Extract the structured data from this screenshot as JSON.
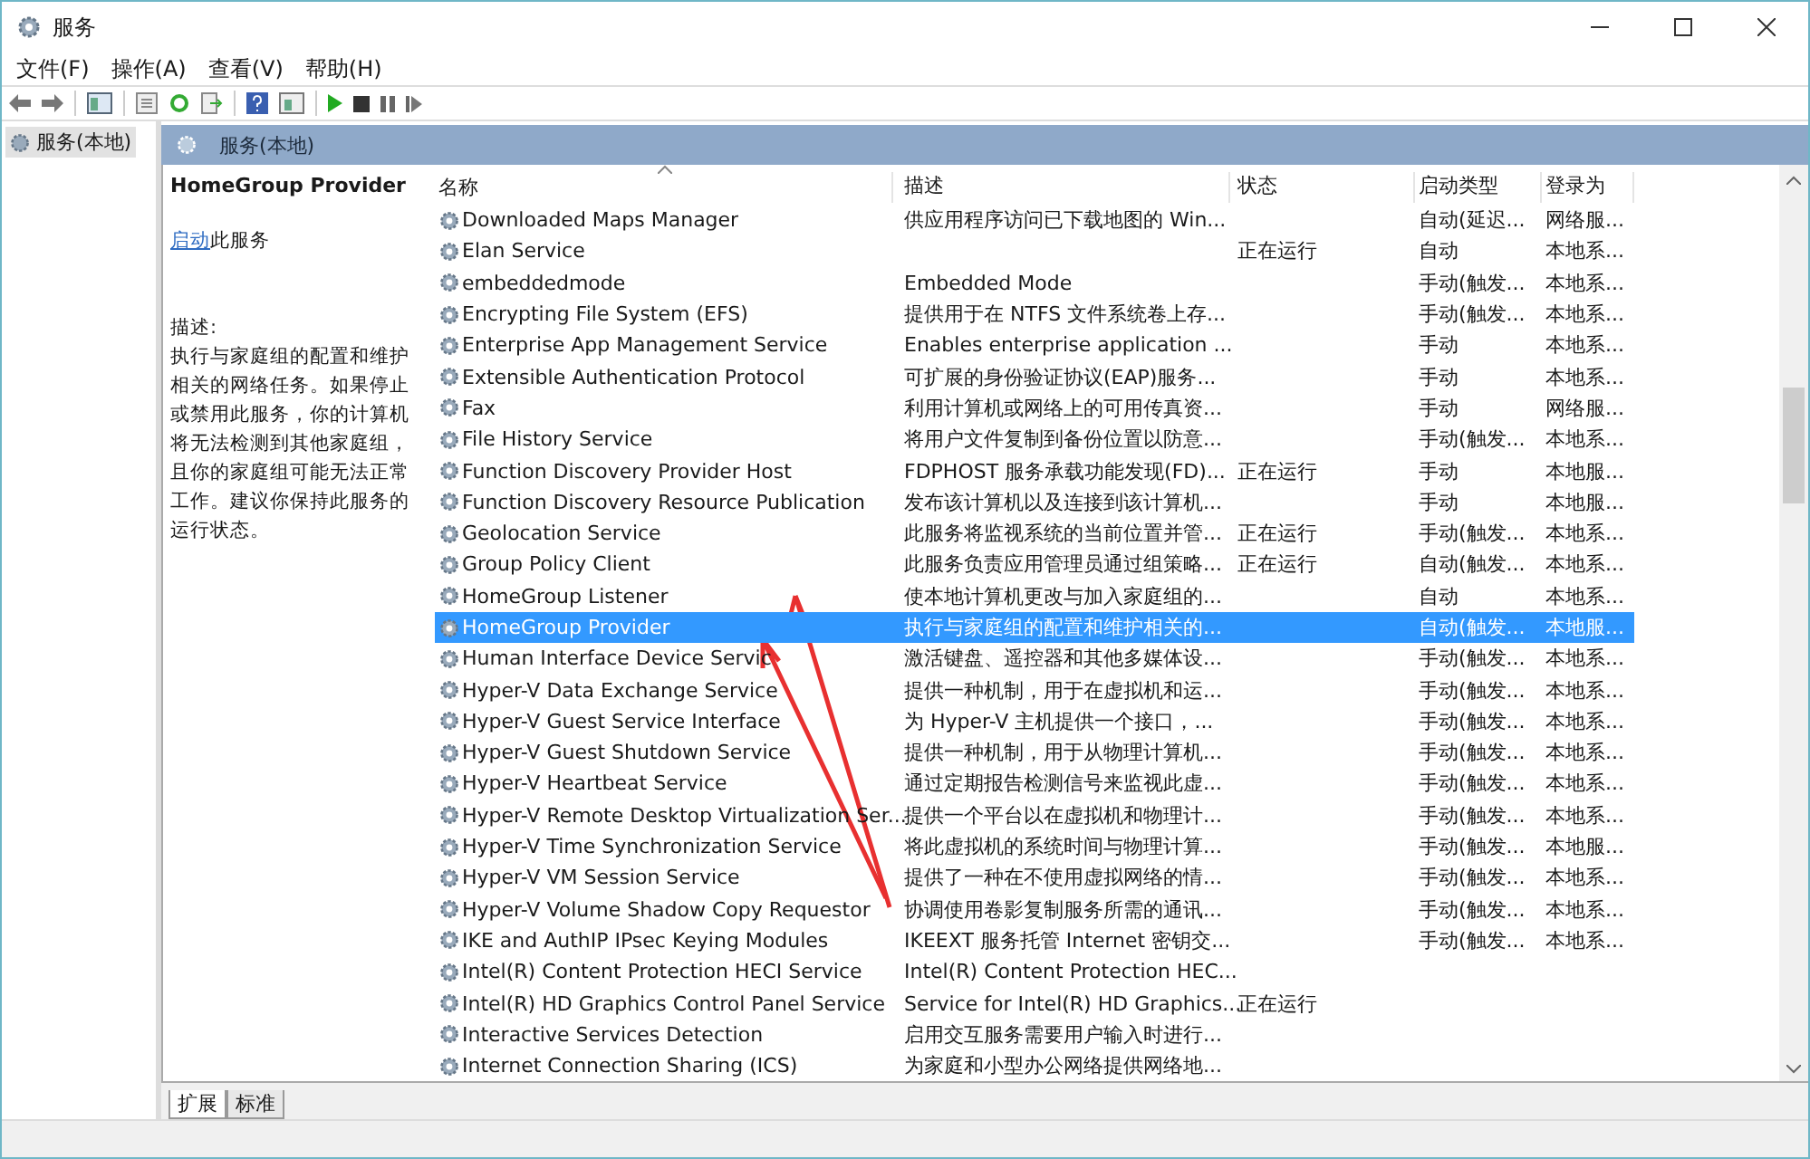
{
  "window": {
    "title": "服务"
  },
  "menu": [
    "文件(F)",
    "操作(A)",
    "查看(V)",
    "帮助(H)"
  ],
  "tree": {
    "items": [
      {
        "label": "服务(本地)",
        "selected": true
      }
    ]
  },
  "panel_header": "服务(本地)",
  "details": {
    "title": "HomeGroup Provider",
    "action_link": "启动",
    "action_text": "此服务",
    "description_label": "描述:",
    "description": "执行与家庭组的配置和维护相关的网络任务。如果停止或禁用此服务，你的计算机将无法检测到其他家庭组，且你的家庭组可能无法正常工作。建议你保持此服务的运行状态。"
  },
  "table": {
    "columns": [
      "名称",
      "描述",
      "状态",
      "启动类型",
      "登录为"
    ],
    "rows": [
      {
        "name": "Downloaded Maps Manager",
        "description": "供应用程序访问已下载地图的 Win...",
        "startup": "自动(延迟...",
        "logon": "网络服...",
        "selected": false
      },
      {
        "name": "Elan Service",
        "status": "正在运行",
        "startup": "自动",
        "logon": "本地系...",
        "selected": false
      },
      {
        "name": "embeddedmode",
        "description": "Embedded Mode",
        "startup": "手动(触发...",
        "logon": "本地系...",
        "selected": false
      },
      {
        "name": "Encrypting File System (EFS)",
        "description": "提供用于在 NTFS 文件系统卷上存...",
        "startup": "手动(触发...",
        "logon": "本地系...",
        "selected": false
      },
      {
        "name": "Enterprise App Management Service",
        "description": "Enables enterprise application ...",
        "startup": "手动",
        "logon": "本地系...",
        "selected": false
      },
      {
        "name": "Extensible Authentication Protocol",
        "description": "可扩展的身份验证协议(EAP)服务...",
        "startup": "手动",
        "logon": "本地系...",
        "selected": false
      },
      {
        "name": "Fax",
        "description": "利用计算机或网络上的可用传真资...",
        "startup": "手动",
        "logon": "网络服...",
        "selected": false
      },
      {
        "name": "File History Service",
        "description": "将用户文件复制到备份位置以防意...",
        "startup": "手动(触发...",
        "logon": "本地系...",
        "selected": false
      },
      {
        "name": "Function Discovery Provider Host",
        "description": "FDPHOST 服务承载功能发现(FD)...",
        "status": "正在运行",
        "startup": "手动",
        "logon": "本地服...",
        "selected": false
      },
      {
        "name": "Function Discovery Resource Publication",
        "description": "发布该计算机以及连接到该计算机...",
        "startup": "手动",
        "logon": "本地服...",
        "selected": false
      },
      {
        "name": "Geolocation Service",
        "description": "此服务将监视系统的当前位置并管...",
        "status": "正在运行",
        "startup": "手动(触发...",
        "logon": "本地系...",
        "selected": false
      },
      {
        "name": "Group Policy Client",
        "description": "此服务负责应用管理员通过组策略...",
        "status": "正在运行",
        "startup": "自动(触发...",
        "logon": "本地系...",
        "selected": false
      },
      {
        "name": "HomeGroup Listener",
        "description": "使本地计算机更改与加入家庭组的...",
        "startup": "自动",
        "logon": "本地系...",
        "selected": false
      },
      {
        "name": "HomeGroup Provider",
        "description": "执行与家庭组的配置和维护相关的...",
        "startup": "自动(触发...",
        "logon": "本地服...",
        "selected": true
      },
      {
        "name": "Human Interface Device Servic",
        "description": "激活键盘、遥控器和其他多媒体设...",
        "startup": "手动(触发...",
        "logon": "本地系...",
        "selected": false
      },
      {
        "name": "Hyper-V Data Exchange Service",
        "description": "提供一种机制，用于在虚拟机和运...",
        "startup": "手动(触发...",
        "logon": "本地系...",
        "selected": false
      },
      {
        "name": "Hyper-V Guest Service Interface",
        "description": "为 Hyper-V 主机提供一个接口，...",
        "startup": "手动(触发...",
        "logon": "本地系...",
        "selected": false
      },
      {
        "name": "Hyper-V Guest Shutdown Service",
        "description": "提供一种机制，用于从物理计算机...",
        "startup": "手动(触发...",
        "logon": "本地系...",
        "selected": false
      },
      {
        "name": "Hyper-V Heartbeat Service",
        "description": "通过定期报告检测信号来监视此虚...",
        "startup": "手动(触发...",
        "logon": "本地系...",
        "selected": false
      },
      {
        "name": "Hyper-V Remote Desktop Virtualization Ser...",
        "description": "提供一个平台以在虚拟机和物理计...",
        "startup": "手动(触发...",
        "logon": "本地系...",
        "selected": false
      },
      {
        "name": "Hyper-V Time Synchronization Service",
        "description": "将此虚拟机的系统时间与物理计算...",
        "startup": "手动(触发...",
        "logon": "本地服...",
        "selected": false
      },
      {
        "name": "Hyper-V VM Session Service",
        "description": "提供了一种在不使用虚拟网络的情...",
        "startup": "手动(触发...",
        "logon": "本地系...",
        "selected": false
      },
      {
        "name": "Hyper-V Volume Shadow Copy Requestor",
        "description": "协调使用卷影复制服务所需的通讯...",
        "startup": "手动(触发...",
        "logon": "本地系...",
        "selected": false
      },
      {
        "name": "IKE and AuthIP IPsec Keying Modules",
        "description": "IKEEXT 服务托管 Internet 密钥交...",
        "startup": "手动(触发...",
        "logon": "本地系...",
        "selected": false
      },
      {
        "name": "Intel(R) Content Protection HECI Service",
        "description": "Intel(R) Content Protection HEC...",
        "selected": false
      },
      {
        "name": "Intel(R) HD Graphics Control Panel Service",
        "description": "Service for Intel(R) HD Graphics...",
        "status": "正在运行",
        "selected": false
      },
      {
        "name": "Interactive Services Detection",
        "description": "启用交互服务需要用户输入时进行...",
        "selected": false
      },
      {
        "name": "Internet Connection Sharing (ICS)",
        "description": "为家庭和小型办公网络提供网络地...",
        "selected": false
      }
    ]
  },
  "bottom_tabs": [
    {
      "label": "扩展",
      "selected": true
    },
    {
      "label": "标准",
      "selected": false
    }
  ]
}
